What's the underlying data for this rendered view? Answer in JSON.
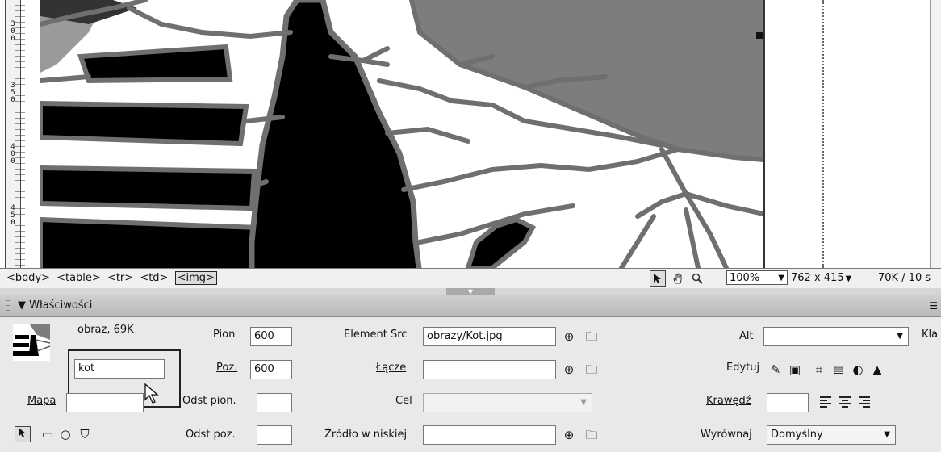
{
  "ruler": {
    "ticks": [
      "3\n0\n0",
      "3\n5\n0",
      "4\n0\n0",
      "4\n5\n0"
    ]
  },
  "status_bar": {
    "tags": [
      "<body>",
      "<table>",
      "<tr>",
      "<td>",
      "<img>"
    ],
    "selected_tag": "<img>",
    "zoom": "100%",
    "window_size": "762 x 415",
    "download_size": "70K / 10 s"
  },
  "panel": {
    "title": "Właściwości",
    "collapse_glyph": "▼",
    "image_info": "obraz, 69K",
    "name_value": "kot",
    "width_label": "Pion",
    "width_value": "600",
    "height_label": "Poz.",
    "height_value": "600",
    "src_label": "Element Src",
    "src_value": "obrazy/Kot.jpg",
    "link_label": "Łącze",
    "link_value": "",
    "target_label": "Cel",
    "target_value": "",
    "lowsrc_label": "Źródło w niskiej",
    "lowsrc_value": "",
    "alt_label": "Alt",
    "alt_value": "",
    "class_label": "Kla",
    "edit_label": "Edytuj",
    "border_label": "Krawędź",
    "border_value": "",
    "align_label": "Wyrównaj",
    "align_value": "Domyślny",
    "map_label": "Mapa",
    "map_value": "",
    "vspace_label": "Odst pion.",
    "vspace_value": "",
    "hspace_label": "Odst poz.",
    "hspace_value": ""
  },
  "colors": {
    "panel_bg": "#e9e9e9",
    "sky": "#7a7a7a",
    "outline": "#6f6f6f"
  }
}
